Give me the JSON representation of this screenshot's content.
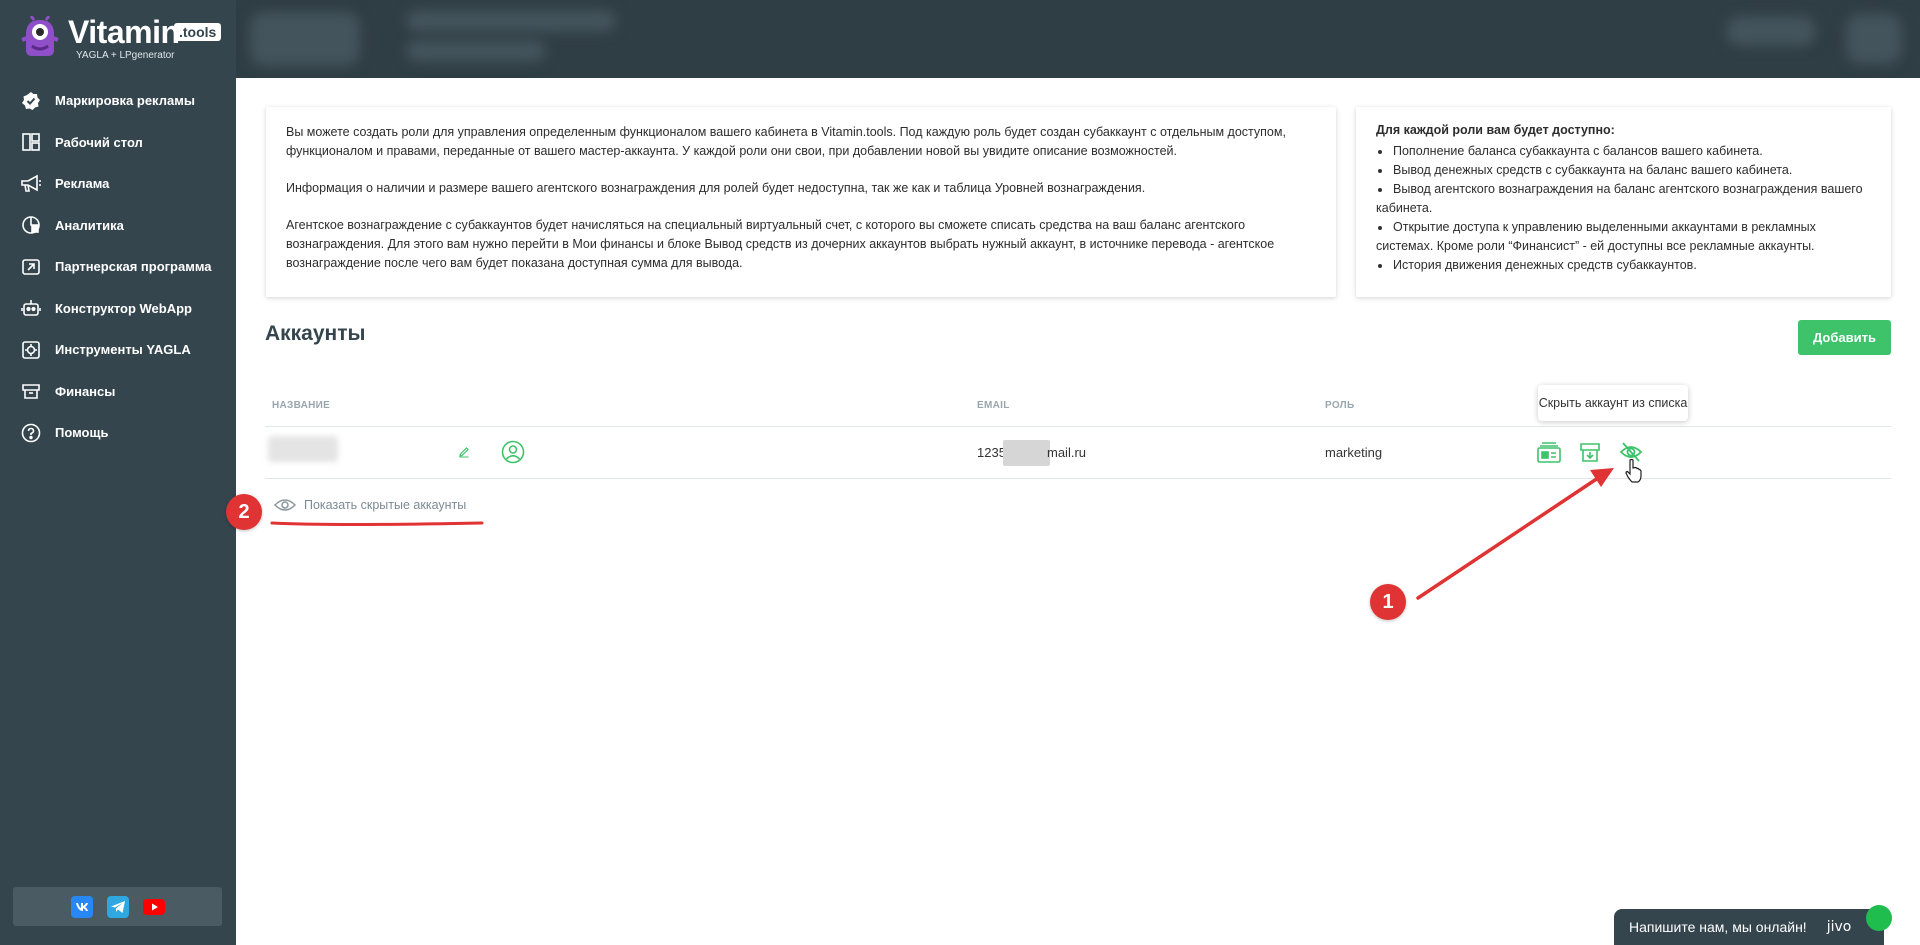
{
  "brand": {
    "title": "Vitamin",
    "badge": ".tools",
    "subtitle": "YAGLA + LPgenerator"
  },
  "sidebar": {
    "items": [
      {
        "label": "Маркировка рекламы",
        "icon": "verified-badge-icon"
      },
      {
        "label": "Рабочий стол",
        "icon": "dashboard-icon"
      },
      {
        "label": "Реклама",
        "icon": "megaphone-icon"
      },
      {
        "label": "Аналитика",
        "icon": "analytics-icon"
      },
      {
        "label": "Партнерская программа",
        "icon": "partner-card-icon"
      },
      {
        "label": "Конструктор WebApp",
        "icon": "webapp-bot-icon"
      },
      {
        "label": "Инструменты YAGLA",
        "icon": "tools-gear-icon"
      },
      {
        "label": "Финансы",
        "icon": "finance-icon"
      },
      {
        "label": "Помощь",
        "icon": "help-icon"
      }
    ],
    "social": [
      "vk-icon",
      "telegram-icon",
      "youtube-icon"
    ]
  },
  "info": {
    "p1": "Вы можете создать роли для управления определенным функционалом вашего кабинета в Vitamin.tools. Под каждую роль будет создан субаккаунт с отдельным доступом, функционалом и правами, переданные от вашего мастер-аккаунта. У каждой роли они свои, при добавлении новой вы увидите описание возможностей.",
    "p2": "Информация о наличии и размере вашего агентского вознаграждения для ролей будет недоступна, так же как и таблица Уровней вознаграждения.",
    "p3": "Агентское вознаграждение с субаккаунтов будет начисляться на специальный виртуальный счет, с которого вы сможете списать средства на ваш баланс агентского вознаграждения. Для этого вам нужно перейти в Мои финансы и блоке Вывод средств из дочерних аккаунтов выбрать нужный аккаунт, в источнике перевода - агентское вознаграждение после чего вам будет показана доступная сумма для вывода."
  },
  "roles_info": {
    "heading": "Для каждой роли вам будет доступно:",
    "items": [
      "Пополнение баланса субаккаунта с балансов вашего кабинета.",
      "Вывод денежных средств с субаккаунта на баланс вашего кабинета.",
      "Вывод агентского вознаграждения на баланс агентского вознаграждения вашего кабинета.",
      "Открытие доступа к управлению выделенными аккаунтами в рекламных системах. Кроме роли “Финансист” - ей доступны все рекламные аккаунты.",
      "История движения денежных средств субаккаунтов."
    ]
  },
  "accounts": {
    "title": "Аккаунты",
    "add_label": "Добавить",
    "columns": {
      "name": "НАЗВАНИЕ",
      "email": "EMAIL",
      "role": "РОЛЬ"
    },
    "rows": [
      {
        "email_prefix": "1235",
        "email_suffix": "mail.ru",
        "role": "marketing"
      }
    ],
    "tooltip": "Скрыть аккаунт из списка",
    "show_hidden": "Показать скрытые аккаунты"
  },
  "annotations": {
    "one": "1",
    "two": "2",
    "color": "#e03333"
  },
  "chat": {
    "label": "Напишите нам, мы онлайн!",
    "brand": "jivo"
  },
  "colors": {
    "accent": "#3ec26a",
    "sidebar": "#34454e"
  }
}
